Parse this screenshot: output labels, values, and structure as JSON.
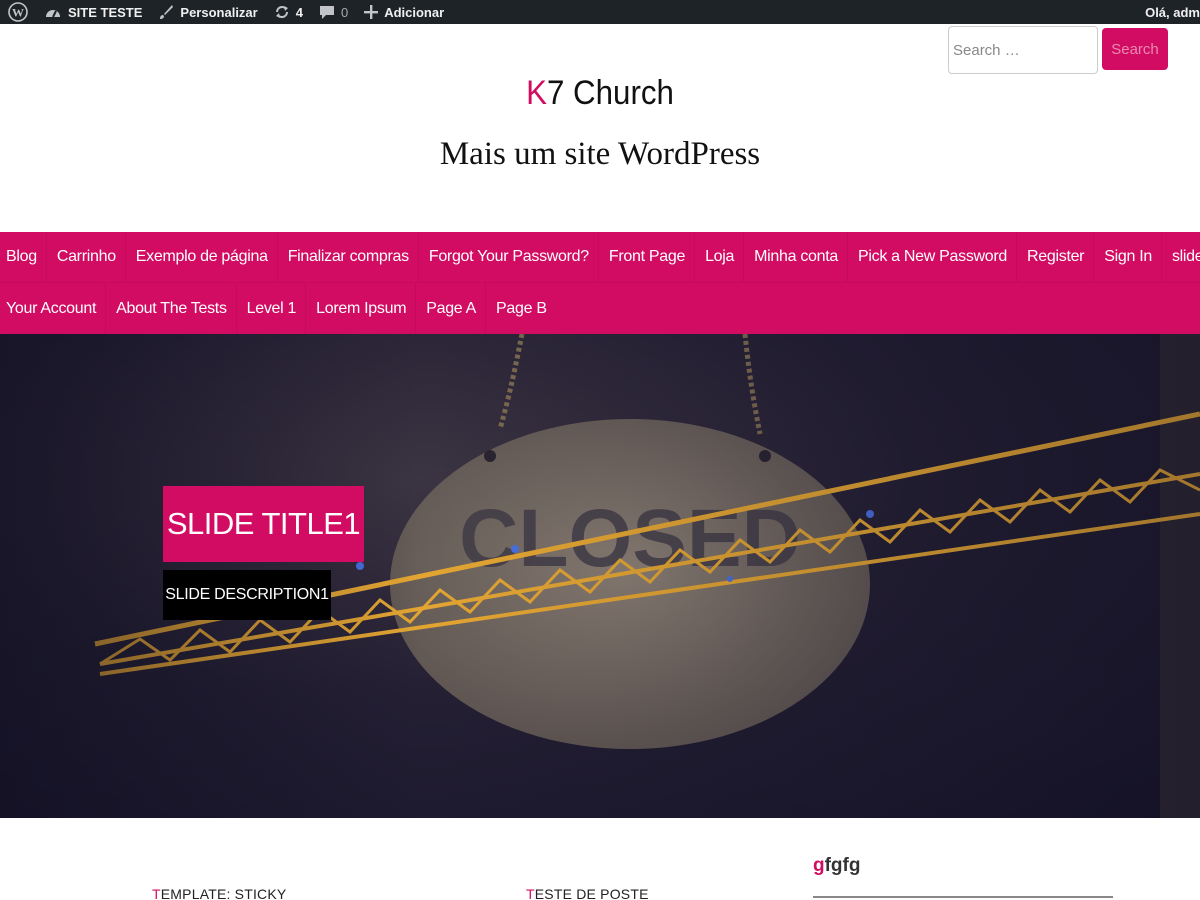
{
  "admin_bar": {
    "site_name": "SITE TESTE",
    "customize": "Personalizar",
    "updates_count": "4",
    "comments_count": "0",
    "new": "Adicionar",
    "greeting": "Olá, adm"
  },
  "header": {
    "search_placeholder": "Search …",
    "search_button": "Search",
    "site_title_first": "K",
    "site_title_rest": "7 Church",
    "tagline": "Mais um site WordPress"
  },
  "nav": {
    "row1": [
      "Blog",
      "Carrinho",
      "Exemplo de página",
      "Finalizar compras",
      "Forgot Your Password?",
      "Front Page",
      "Loja",
      "Minha conta",
      "Pick a New Password",
      "Register",
      "Sign In",
      "slide"
    ],
    "row2": [
      "Your Account",
      "About The Tests",
      "Level 1",
      "Lorem Ipsum",
      "Page A",
      "Page B"
    ]
  },
  "slider": {
    "title": "SLIDE TITLE1",
    "description": "SLIDE DESCRIPTION1"
  },
  "posts": [
    {
      "first": "T",
      "rest": "EMPLATE: STICKY"
    },
    {
      "first": "T",
      "rest": "ESTE DE POSTE"
    }
  ],
  "sidebar": {
    "widget_title_first": "g",
    "widget_title_rest": "fgfg"
  },
  "colors": {
    "accent": "#d20c62",
    "admin_bar": "#1d2327"
  }
}
